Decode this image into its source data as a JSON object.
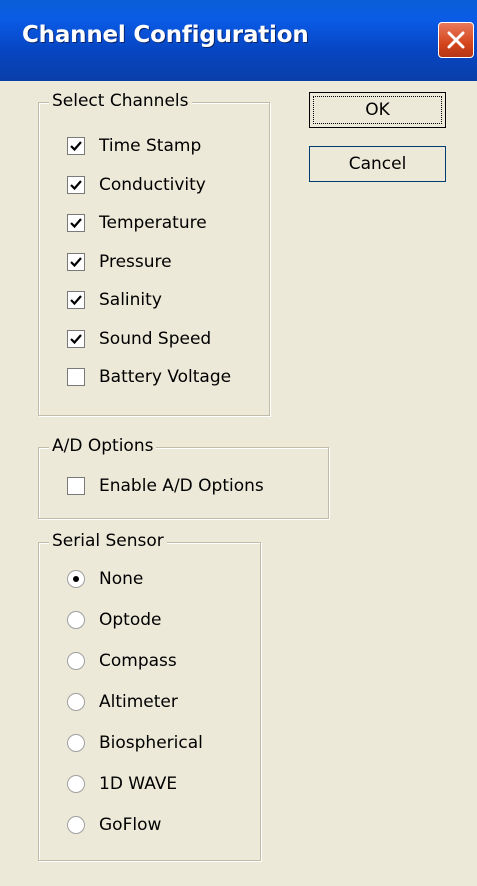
{
  "window": {
    "title": "Channel Configuration"
  },
  "buttons": {
    "ok": "OK",
    "cancel": "Cancel"
  },
  "select_channels": {
    "label": "Select Channels",
    "items": [
      {
        "label": "Time Stamp",
        "checked": true
      },
      {
        "label": "Conductivity",
        "checked": true
      },
      {
        "label": "Temperature",
        "checked": true
      },
      {
        "label": "Pressure",
        "checked": true
      },
      {
        "label": "Salinity",
        "checked": true
      },
      {
        "label": "Sound Speed",
        "checked": true
      },
      {
        "label": "Battery Voltage",
        "checked": false
      }
    ]
  },
  "ad_options": {
    "label": "A/D Options",
    "items": [
      {
        "label": "Enable A/D Options",
        "checked": false
      }
    ]
  },
  "serial_sensor": {
    "label": "Serial Sensor",
    "selected": "None",
    "items": [
      {
        "label": "None"
      },
      {
        "label": "Optode"
      },
      {
        "label": "Compass"
      },
      {
        "label": "Altimeter"
      },
      {
        "label": "Biospherical"
      },
      {
        "label": "1D WAVE"
      },
      {
        "label": "GoFlow"
      }
    ]
  },
  "colors": {
    "titlebar": "#0a5be6",
    "close_button": "#d4461d",
    "dialog_bg": "#ece9d8"
  }
}
